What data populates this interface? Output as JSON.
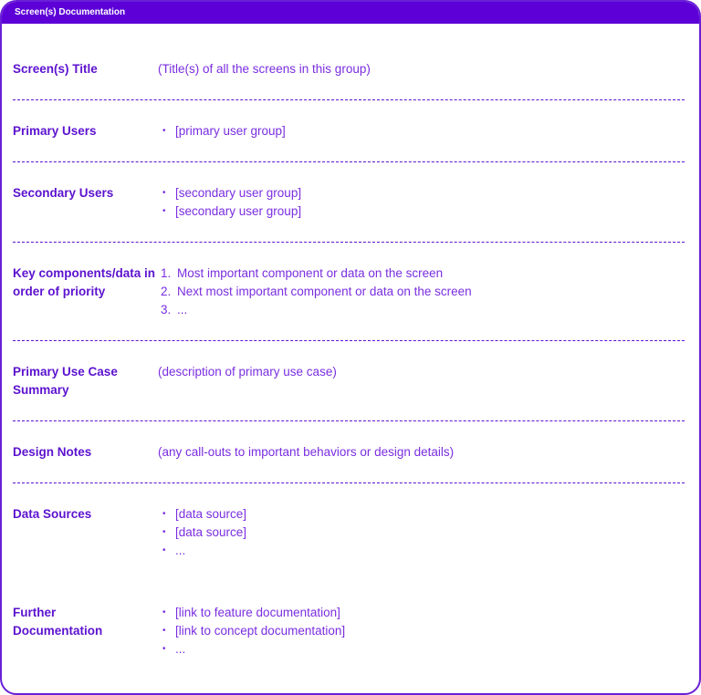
{
  "header": {
    "title": "Screen(s) Documentation"
  },
  "colors": {
    "accent": "#5c00d7",
    "label": "#5c12cf",
    "value": "#7a2ee0"
  },
  "sections": {
    "title": {
      "label": "Screen(s) Title",
      "value": "(Title(s) of all the screens in this group)"
    },
    "primary_users": {
      "label": "Primary Users",
      "items": [
        "[primary user group]"
      ]
    },
    "secondary_users": {
      "label": "Secondary Users",
      "items": [
        "[secondary user group]",
        "[secondary user group]"
      ]
    },
    "key_components": {
      "label": "Key components/data in order of priority",
      "items": [
        "Most important component or data on the screen",
        "Next most important component or data on the screen",
        "..."
      ],
      "numbers": [
        "1.",
        "2.",
        "3."
      ]
    },
    "use_case": {
      "label": "Primary Use Case Summary",
      "value": "(description of primary use case)"
    },
    "design_notes": {
      "label": "Design Notes",
      "value": "(any call-outs to important behaviors or design details)"
    },
    "data_sources": {
      "label": "Data Sources",
      "items": [
        "[data source]",
        "[data source]",
        "..."
      ]
    },
    "further_docs": {
      "label": "Further Documentation",
      "items": [
        "[link to feature documentation]",
        "[link to concept documentation]",
        "..."
      ]
    }
  },
  "bullet_glyph": "•"
}
